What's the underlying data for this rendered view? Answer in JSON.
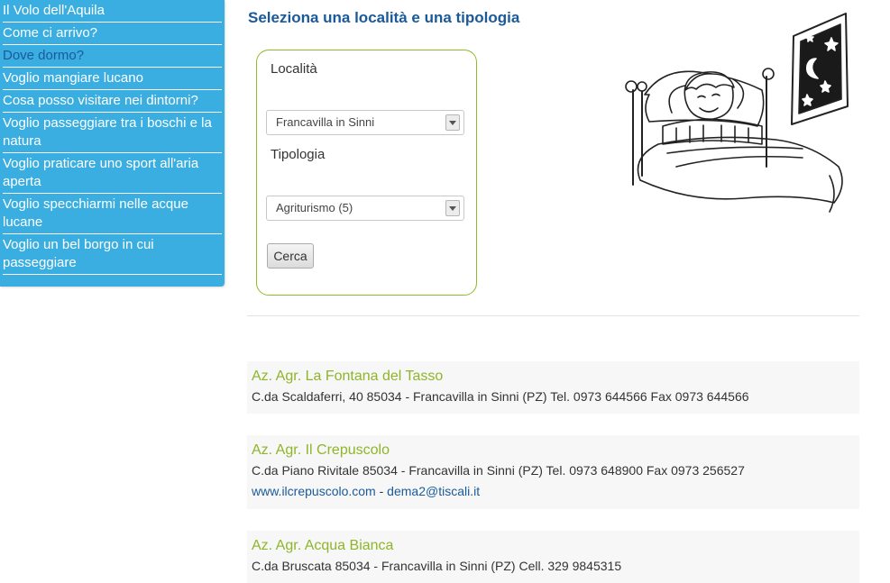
{
  "sidebar": {
    "items": [
      {
        "label": "Il Volo dell'Aquila"
      },
      {
        "label": "Come ci arrivo?"
      },
      {
        "label": "Dove dormo?"
      },
      {
        "label": "Voglio mangiare lucano"
      },
      {
        "label": "Cosa posso visitare nei dintorni?"
      },
      {
        "label": "Voglio passeggiare tra i boschi e la natura"
      },
      {
        "label": "Voglio praticare uno sport all'aria aperta"
      },
      {
        "label": "Voglio specchiarmi nelle acque lucane"
      },
      {
        "label": "Voglio un bel borgo in cui passeggiare"
      }
    ],
    "active_index": 2
  },
  "page": {
    "heading": "Seleziona una località e una tipologia"
  },
  "form": {
    "locality_label": "Località",
    "locality_value": "Francavilla in Sinni",
    "type_label": "Tipologia",
    "type_value": "Agriturismo (5)",
    "search_button": "Cerca"
  },
  "results": [
    {
      "name": "Az. Agr. La Fontana del Tasso",
      "address": "C.da Scaldaferri, 40 85034 - Francavilla in Sinni (PZ) Tel. 0973 644566 Fax 0973 644566"
    },
    {
      "name": "Az. Agr. Il Crepuscolo",
      "address": "C.da Piano Rivitale 85034 - Francavilla in Sinni (PZ) Tel. 0973 648900 Fax 0973 256527",
      "website": "www.ilcrepuscolo.com",
      "separator": "-",
      "email": "dema2@tiscali.it"
    },
    {
      "name": "Az. Agr. Acqua Bianca",
      "address": "C.da Bruscata 85034 - Francavilla in Sinni (PZ) Cell. 329 9845315"
    }
  ],
  "colors": {
    "sidebar_bg": "#3aaee0",
    "active_link": "#1a5a9a",
    "result_name": "#8fb52a",
    "form_border": "#8dbb2a"
  },
  "icons": {
    "illustration": "sleeping-person-in-bed-illustration",
    "select_arrow": "chevron-down-icon"
  }
}
